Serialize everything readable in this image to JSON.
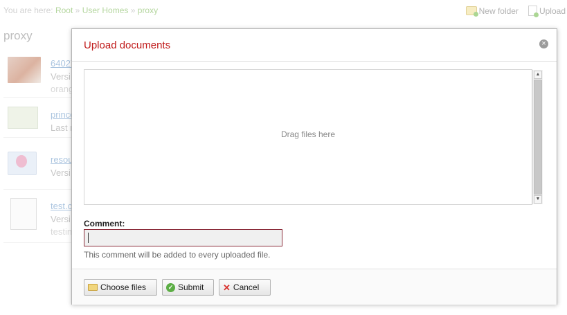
{
  "breadcrumb": {
    "prefix": "You are here:",
    "items": [
      "Root",
      "User Homes",
      "proxy"
    ],
    "separator": "»"
  },
  "top_actions": {
    "new_folder": "New folder",
    "upload": "Upload"
  },
  "folder_title": "proxy",
  "documents": [
    {
      "name": "64027",
      "line2": "Versi",
      "line3": "orang"
    },
    {
      "name": "prince",
      "line2": "Last r",
      "line3": ""
    },
    {
      "name": "resou",
      "line2": "Versi",
      "line3": ""
    },
    {
      "name": "test.c",
      "line2": "Versi",
      "line3": "testin"
    }
  ],
  "dialog": {
    "title": "Upload documents",
    "dropzone_text": "Drag files here",
    "comment_label": "Comment:",
    "comment_value": "",
    "comment_hint": "This comment will be added to every uploaded file.",
    "buttons": {
      "choose": "Choose files",
      "submit": "Submit",
      "cancel": "Cancel"
    }
  },
  "colors": {
    "dialog_title": "#c01a1a",
    "breadcrumb_link": "#8cc06a",
    "input_border": "#8b2c3a"
  }
}
